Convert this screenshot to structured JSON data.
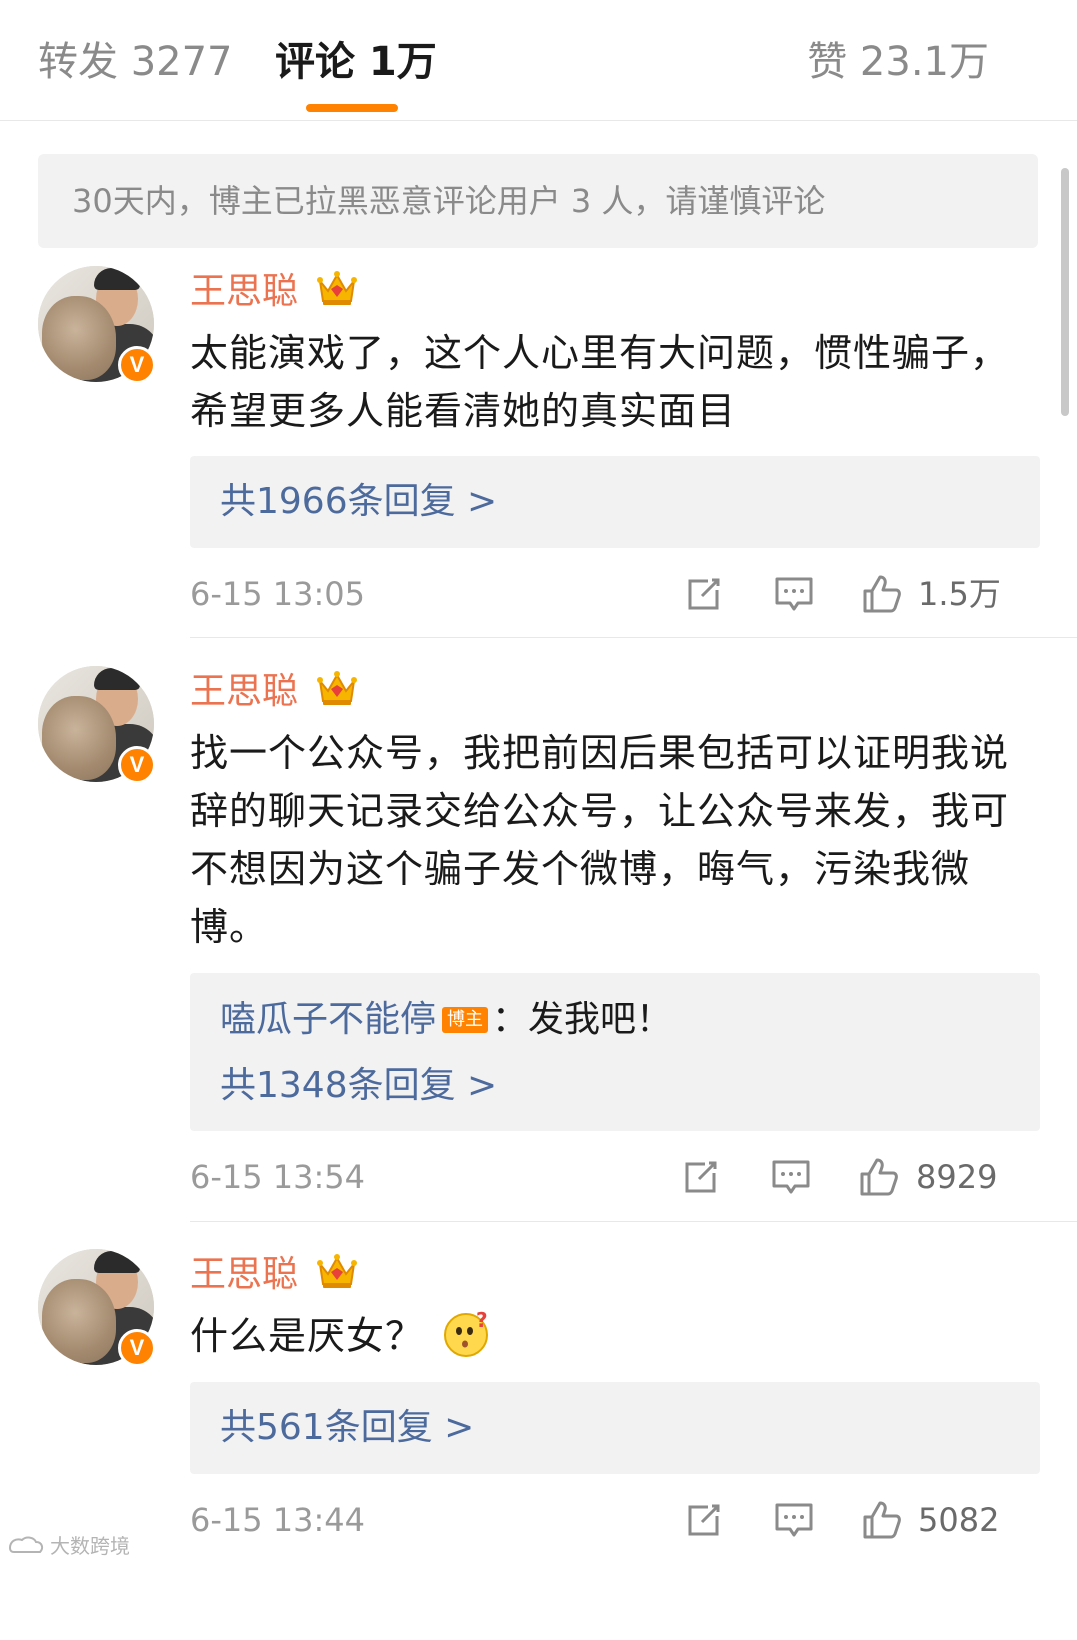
{
  "tabs": {
    "repost": "转发 3277",
    "comment": "评论 1万",
    "like": "赞 23.1万"
  },
  "notice": "30天内，博主已拉黑恶意评论用户 3 人，请谨慎评论",
  "comments": [
    {
      "username": "王思聪",
      "badge": "V",
      "text": "太能演戏了，这个人心里有大问题，惯性骗子，希望更多人能看清她的真实面目",
      "reply_count_label": "共1966条回复 >",
      "time": "6-15 13:05",
      "likes": "1.5万"
    },
    {
      "username": "王思聪",
      "badge": "V",
      "text": "找一个公众号，我把前因后果包括可以证明我说辞的聊天记录交给公众号，让公众号来发，我可不想因为这个骗子发个微博，晦气，污染我微博。",
      "reply_preview": {
        "name": "嗑瓜子不能停",
        "tag": "博主",
        "text": "：发我吧！"
      },
      "reply_count_label": "共1348条回复 >",
      "time": "6-15 13:54",
      "likes": "8929"
    },
    {
      "username": "王思聪",
      "badge": "V",
      "text": "什么是厌女？",
      "reply_count_label": "共561条回复 >",
      "time": "6-15 13:44",
      "likes": "5082"
    }
  ],
  "watermark": "大数跨境",
  "colors": {
    "accent": "#ff8200",
    "username": "#eb7350",
    "link": "#4d6a9c"
  },
  "icons": [
    "share-icon",
    "comment-icon",
    "like-icon",
    "crown-icon",
    "verified-badge",
    "thinking-emoji"
  ]
}
